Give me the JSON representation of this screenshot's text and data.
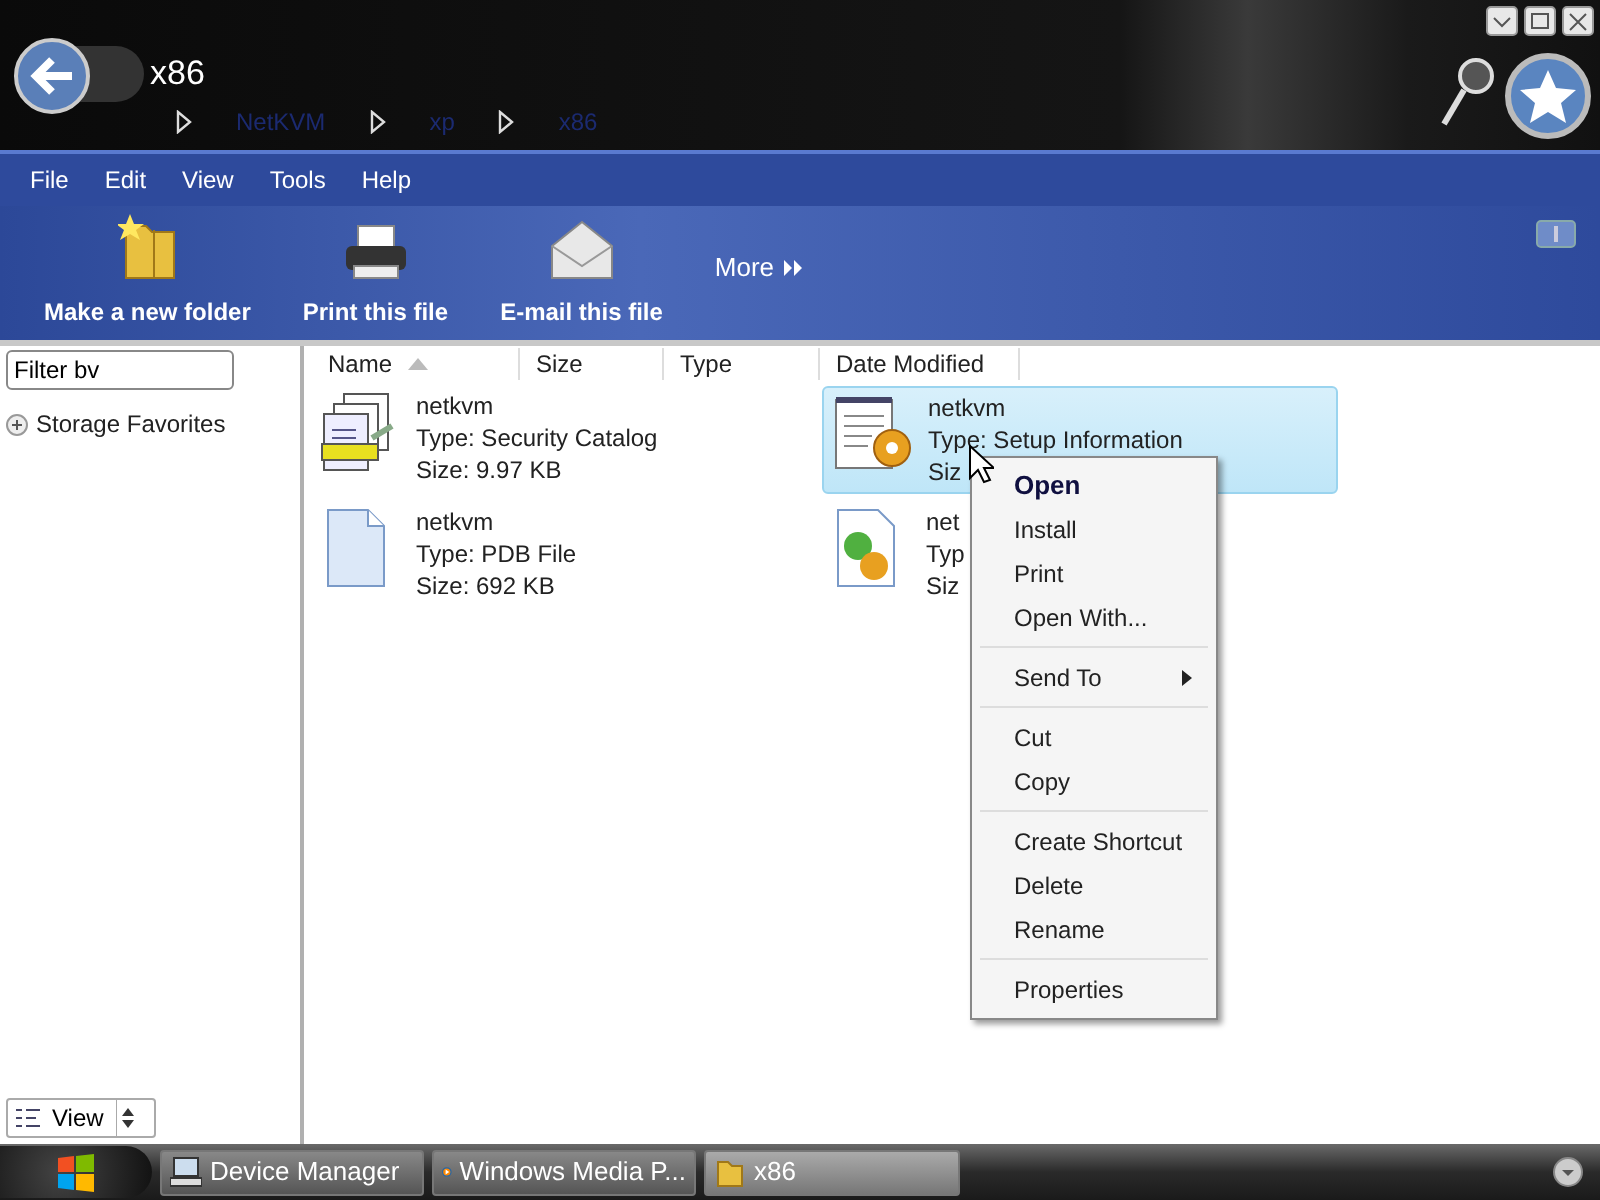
{
  "window": {
    "title": "x86",
    "breadcrumbs": [
      "NetKVM",
      "xp",
      "x86"
    ]
  },
  "menu_bar": [
    "File",
    "Edit",
    "View",
    "Tools",
    "Help"
  ],
  "toolbar": [
    {
      "label": "Make a new folder",
      "kind": "folder"
    },
    {
      "label": "Print this file",
      "kind": "printer"
    },
    {
      "label": "E-mail this file",
      "kind": "mail"
    },
    {
      "label": "More",
      "kind": "more"
    }
  ],
  "sidebar": {
    "filter": {
      "value": "Filter bv"
    },
    "items": [
      {
        "label": "Storage Favorites",
        "expanded": false
      }
    ],
    "view_button": "View"
  },
  "columns": [
    {
      "label": "Name",
      "sorted": true
    },
    {
      "label": "Size",
      "sorted": false
    },
    {
      "label": "Type",
      "sorted": false
    },
    {
      "label": "Date Modified",
      "sorted": false
    }
  ],
  "files": [
    {
      "name": "netkvm",
      "type": "Type: Security Catalog",
      "size": "Size: 9.97 KB",
      "kind": "catalog",
      "selected": false
    },
    {
      "name": "netkvm",
      "type": "Type: Setup Information",
      "size": "Siz",
      "kind": "setup",
      "selected": true
    },
    {
      "name": "netkvm",
      "type": "Type: PDB File",
      "size": "Size: 692 KB",
      "kind": "document",
      "selected": false
    },
    {
      "name": "net",
      "type": "Typ",
      "size": "Siz",
      "kind": "component",
      "selected": false
    }
  ],
  "context_menu": [
    {
      "kind": "item",
      "label": "Open",
      "default": true,
      "submenu": false
    },
    {
      "kind": "item",
      "label": "Install",
      "default": false,
      "submenu": false
    },
    {
      "kind": "item",
      "label": "Print",
      "default": false,
      "submenu": false
    },
    {
      "kind": "item",
      "label": "Open With...",
      "default": false,
      "submenu": false
    },
    {
      "kind": "separator"
    },
    {
      "kind": "item",
      "label": "Send To",
      "default": false,
      "submenu": true
    },
    {
      "kind": "separator"
    },
    {
      "kind": "item",
      "label": "Cut",
      "default": false,
      "submenu": false
    },
    {
      "kind": "item",
      "label": "Copy",
      "default": false,
      "submenu": false
    },
    {
      "kind": "separator"
    },
    {
      "kind": "item",
      "label": "Create Shortcut",
      "default": false,
      "submenu": false
    },
    {
      "kind": "item",
      "label": "Delete",
      "default": false,
      "submenu": false
    },
    {
      "kind": "item",
      "label": "Rename",
      "default": false,
      "submenu": false
    },
    {
      "kind": "separator"
    },
    {
      "kind": "item",
      "label": "Properties",
      "default": false,
      "submenu": false
    }
  ],
  "taskbar": [
    {
      "label": "Device Manager",
      "kind": "computer",
      "selected": false
    },
    {
      "label": "Windows Media P...",
      "kind": "media",
      "selected": false
    },
    {
      "label": "x86",
      "kind": "folder",
      "selected": true
    }
  ]
}
